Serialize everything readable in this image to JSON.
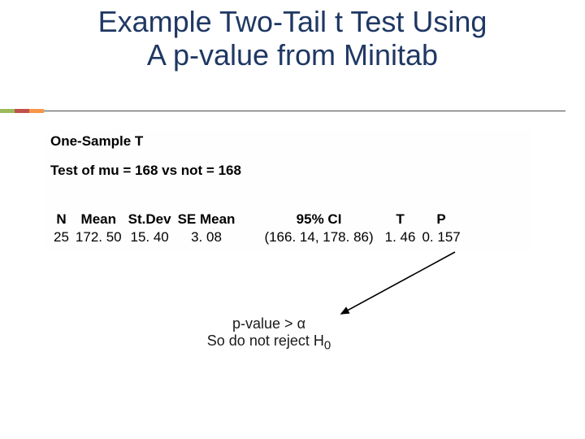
{
  "title_line1": "Example Two-Tail t Test Using",
  "title_line2": "A  p-value from Minitab",
  "output": {
    "header": "One-Sample T",
    "test_of": "Test of mu = 168 vs not = 168",
    "cols": {
      "n": "N",
      "mean": "Mean",
      "stdev": "St.Dev",
      "semean": "SE Mean",
      "ci": "95% CI",
      "t": "T",
      "p": "P"
    },
    "vals": {
      "n": "25",
      "mean": "172. 50",
      "stdev": "15. 40",
      "semean": "3. 08",
      "ci": "(166. 14, 178. 86)",
      "t": "1. 46",
      "p": "0. 157"
    }
  },
  "conclusion": {
    "line1_a": "p-value > ",
    "line1_alpha": "α",
    "line2_a": "So do not reject H",
    "line2_sub": "0"
  }
}
